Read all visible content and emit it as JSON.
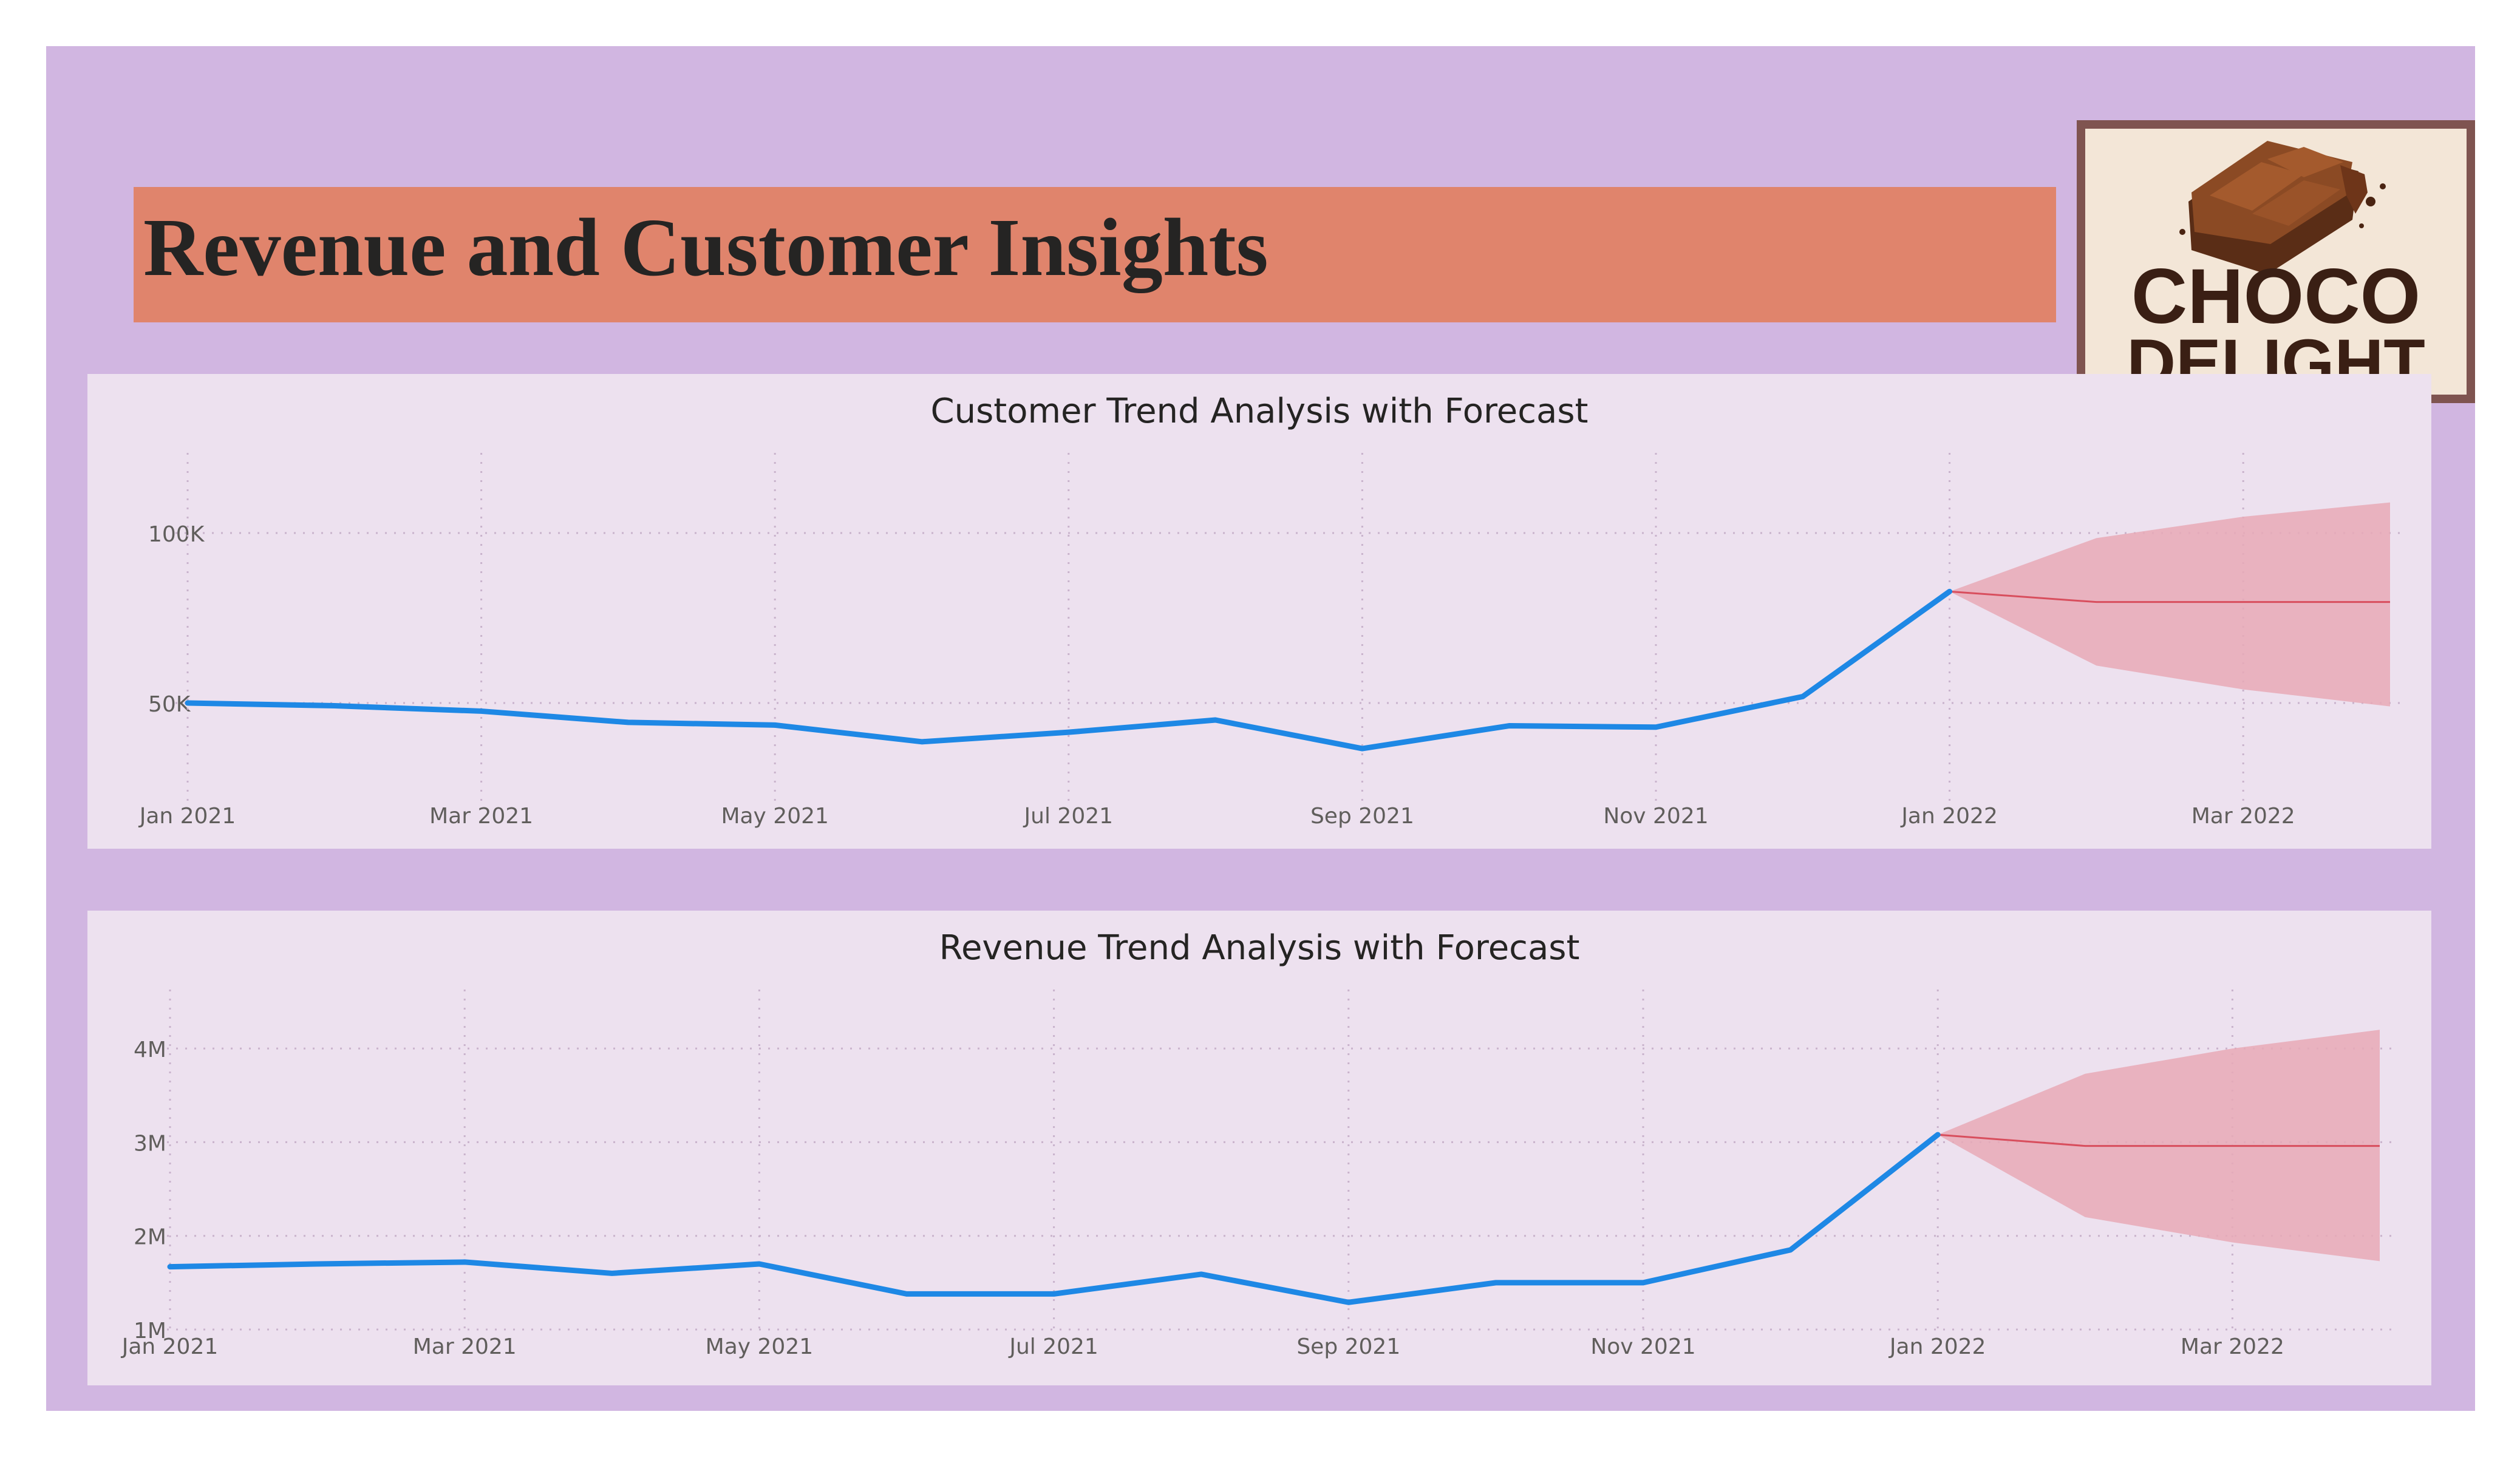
{
  "header": {
    "title": "Revenue and Customer Insights"
  },
  "logo": {
    "line1": "CHOCO",
    "line2": "DELIGHT"
  },
  "colors": {
    "actual": "#1e88e5",
    "forecast_line": "#d84e5d",
    "forecast_band": "#e8a9b6",
    "title_bar": "#e0846c",
    "background": "#d1b6e1",
    "panel": "#ede1ef"
  },
  "chart_data": [
    {
      "type": "line",
      "title": "Customer Trend Analysis with Forecast",
      "xlabel": "",
      "ylabel": "",
      "x": [
        "2021-01",
        "2021-02",
        "2021-03",
        "2021-04",
        "2021-05",
        "2021-06",
        "2021-07",
        "2021-08",
        "2021-09",
        "2021-10",
        "2021-11",
        "2021-12",
        "2022-01"
      ],
      "x_ticks": [
        "Jan 2021",
        "Mar 2021",
        "May 2021",
        "Jul 2021",
        "Sep 2021",
        "Nov 2021",
        "Jan 2022",
        "Mar 2022"
      ],
      "y_ticks": [
        {
          "value": 50000,
          "label": "50K"
        },
        {
          "value": 100000,
          "label": "100K"
        }
      ],
      "ylim": [
        20000,
        120000
      ],
      "grid": true,
      "series": [
        {
          "role": "actual",
          "values": [
            50000,
            49200,
            47600,
            44300,
            43500,
            38600,
            41400,
            45000,
            36600,
            43300,
            42900,
            51900,
            82800
          ]
        }
      ],
      "forecast": {
        "x": [
          "2022-01",
          "2022-02",
          "2022-03",
          "2022-04"
        ],
        "values": [
          82800,
          79700,
          79700,
          79700
        ],
        "upper": [
          82800,
          98500,
          104800,
          109000
        ],
        "lower": [
          82800,
          61000,
          54000,
          49000
        ]
      }
    },
    {
      "type": "line",
      "title": "Revenue Trend Analysis with Forecast",
      "xlabel": "",
      "ylabel": "",
      "x": [
        "2021-01",
        "2021-02",
        "2021-03",
        "2021-04",
        "2021-05",
        "2021-06",
        "2021-07",
        "2021-08",
        "2021-09",
        "2021-10",
        "2021-11",
        "2021-12",
        "2022-01"
      ],
      "x_ticks": [
        "Jan 2021",
        "Mar 2021",
        "May 2021",
        "Jul 2021",
        "Sep 2021",
        "Nov 2021",
        "Jan 2022",
        "Mar 2022"
      ],
      "y_ticks": [
        {
          "value": 1000000,
          "label": "1M"
        },
        {
          "value": 2000000,
          "label": "2M"
        },
        {
          "value": 3000000,
          "label": "3M"
        },
        {
          "value": 4000000,
          "label": "4M"
        }
      ],
      "ylim": [
        1000000,
        4500000
      ],
      "grid": true,
      "series": [
        {
          "role": "actual",
          "values": [
            1670000,
            1700000,
            1720000,
            1600000,
            1700000,
            1380000,
            1380000,
            1590000,
            1290000,
            1500000,
            1500000,
            1850000,
            3080000
          ]
        }
      ],
      "forecast": {
        "x": [
          "2022-01",
          "2022-02",
          "2022-03",
          "2022-04"
        ],
        "values": [
          3080000,
          2960000,
          2960000,
          2960000
        ],
        "upper": [
          3080000,
          3730000,
          4000000,
          4200000
        ],
        "lower": [
          3080000,
          2200000,
          1930000,
          1730000
        ]
      }
    }
  ]
}
